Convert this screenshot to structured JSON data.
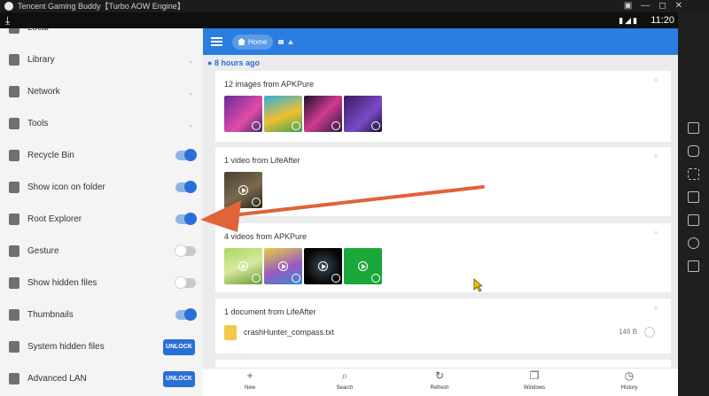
{
  "window": {
    "title": "Tencent Gaming Buddy【Turbo AOW Engine】",
    "controls": [
      "▣",
      "—",
      "◻",
      "✕"
    ]
  },
  "statusbar": {
    "download_icon": "⤓",
    "icons": "▮◢▮",
    "clock": "11:20"
  },
  "drawer": {
    "items": [
      {
        "label": "Local",
        "icon": "local-icon",
        "control": "chevron"
      },
      {
        "label": "Library",
        "icon": "library-icon",
        "control": "chevron"
      },
      {
        "label": "Network",
        "icon": "network-icon",
        "control": "chevron"
      },
      {
        "label": "Tools",
        "icon": "tools-icon",
        "control": "chevron"
      },
      {
        "label": "Recycle Bin",
        "icon": "trash-icon",
        "control": "toggle",
        "on": true
      },
      {
        "label": "Show icon on folder",
        "icon": "folder-image-icon",
        "control": "toggle",
        "on": true
      },
      {
        "label": "Root Explorer",
        "icon": "key-icon",
        "control": "toggle",
        "on": true
      },
      {
        "label": "Gesture",
        "icon": "hand-icon",
        "control": "toggle",
        "on": false
      },
      {
        "label": "Show hidden files",
        "icon": "hidden-files-icon",
        "control": "toggle",
        "on": false
      },
      {
        "label": "Thumbnails",
        "icon": "thumbnails-icon",
        "control": "toggle",
        "on": true
      },
      {
        "label": "System hidden files",
        "icon": "system-files-icon",
        "control": "unlock",
        "button": "UNLOCK"
      },
      {
        "label": "Advanced LAN",
        "icon": "lan-icon",
        "control": "unlock",
        "button": "UNLOCK"
      }
    ]
  },
  "main": {
    "breadcrumb_home": "Home",
    "time_label": "8 hours ago",
    "cards": [
      {
        "title": "12 images from APKPure",
        "type": "images"
      },
      {
        "title": "1 video from LifeAfter",
        "type": "videos"
      },
      {
        "title": "4 videos from APKPure",
        "type": "videos"
      },
      {
        "title": "1 document from LifeAfter",
        "type": "document",
        "doc_name": "crashHunter_compass.txt",
        "doc_size": "146 B"
      }
    ]
  },
  "bottombar": {
    "buttons": [
      {
        "label": "New",
        "icon": "plus-icon"
      },
      {
        "label": "Search",
        "icon": "search-icon"
      },
      {
        "label": "Refresh",
        "icon": "refresh-icon"
      },
      {
        "label": "Windows",
        "icon": "windows-icon"
      },
      {
        "label": "History",
        "icon": "history-icon"
      }
    ]
  },
  "colors": {
    "accent": "#2a7ee0",
    "toggle_on": "#2a6fd6",
    "arrow": "#e2623a"
  }
}
